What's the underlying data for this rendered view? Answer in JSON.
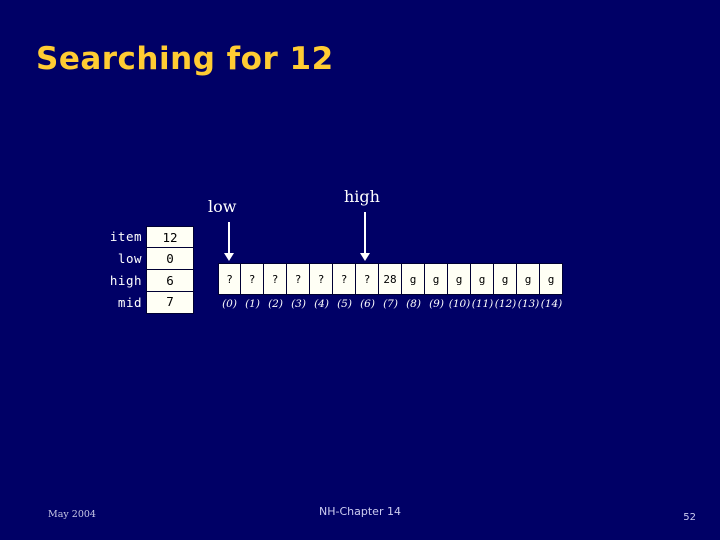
{
  "slide": {
    "title": "Searching for 12",
    "background_color": "#000066",
    "title_color": "#ffcc33"
  },
  "variables": {
    "rows": [
      {
        "label": "item",
        "value": "12"
      },
      {
        "label": "low",
        "value": "0"
      },
      {
        "label": "high",
        "value": "6"
      },
      {
        "label": "mid",
        "value": "7"
      }
    ]
  },
  "pointers": [
    {
      "name": "low",
      "label": "low",
      "target_index": 0
    },
    {
      "name": "high",
      "label": "high",
      "target_index": 6
    }
  ],
  "array": {
    "cells": [
      "?",
      "?",
      "?",
      "?",
      "?",
      "?",
      "?",
      "28",
      "g",
      "g",
      "g",
      "g",
      "g",
      "g",
      "g"
    ],
    "indices": [
      "(0)",
      "(1)",
      "(2)",
      "(3)",
      "(4)",
      "(5)",
      "(6)",
      "(7)",
      "(8)",
      "(9)",
      "(10)",
      "(11)",
      "(12)",
      "(13)",
      "(14)"
    ]
  },
  "footer": {
    "date": "May 2004",
    "center": "NH-Chapter 14",
    "page": "52"
  }
}
